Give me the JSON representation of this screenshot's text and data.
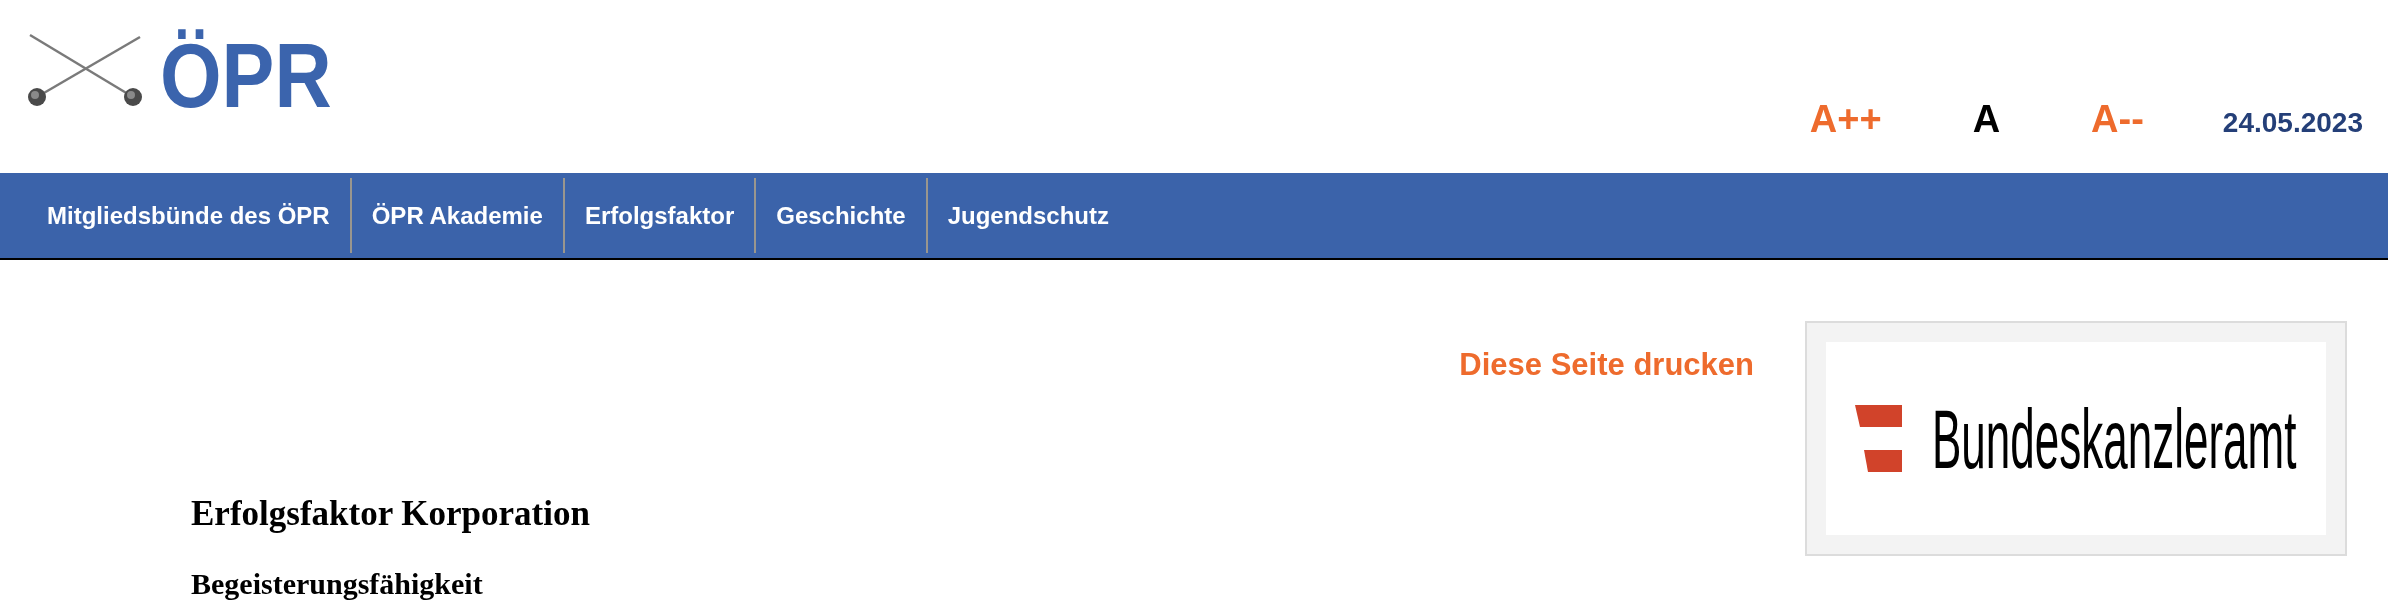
{
  "logo": {
    "text": "ÖPR"
  },
  "font_size_controls": [
    {
      "label": "A++",
      "selected": false
    },
    {
      "label": "A",
      "selected": true
    },
    {
      "label": "A--",
      "selected": false
    }
  ],
  "date": "24.05.2023",
  "nav": {
    "items": [
      "Mitgliedsbünde des ÖPR",
      "ÖPR Akademie",
      "Erfolgsfaktor",
      "Geschichte",
      "Jugendschutz"
    ]
  },
  "print_link": "Diese Seite drucken",
  "content": {
    "title": "Erfolgsfaktor Korporation",
    "subtitle": "Begeisterungsfähigkeit"
  },
  "sidebar": {
    "sponsor": {
      "text": "Bundeskanzleramt"
    }
  }
}
